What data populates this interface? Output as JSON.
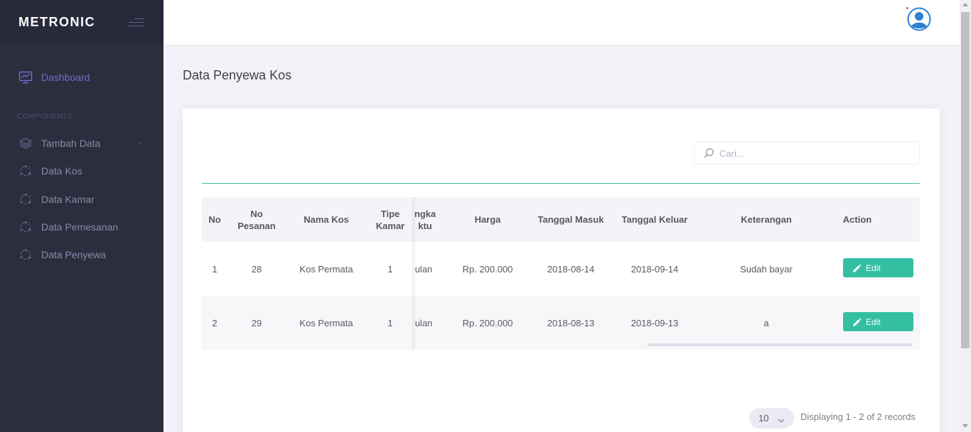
{
  "brand": {
    "logo_text": "METRONIC"
  },
  "sidebar": {
    "section_title": "COMPONENTS",
    "items": [
      {
        "label": "Dashboard",
        "icon": "chart-icon",
        "active": true
      },
      {
        "label": "Tambah Data",
        "icon": "layers-icon",
        "has_submenu": true
      },
      {
        "label": "Data Kos",
        "icon": "network-icon"
      },
      {
        "label": "Data Kamar",
        "icon": "network-icon"
      },
      {
        "label": "Data Pemesanan",
        "icon": "network-icon"
      },
      {
        "label": "Data Penyewa",
        "icon": "network-icon"
      }
    ]
  },
  "page": {
    "title": "Data Penyewa Kos"
  },
  "search": {
    "placeholder": "Cari..."
  },
  "table": {
    "columns": [
      "No",
      "No Pesanan",
      "Nama Kos",
      "Tipe Kamar",
      "ngka ktu",
      "Harga",
      "Tanggal Masuk",
      "Tanggal Keluar",
      "Keterangan",
      "Action"
    ],
    "rows": [
      {
        "no": "1",
        "no_pesanan": "28",
        "nama_kos": "Kos Permata",
        "tipe_kamar": "1",
        "jangka": "ulan",
        "harga": "Rp. 200.000",
        "tanggal_masuk": "2018-08-14",
        "tanggal_keluar": "2018-09-14",
        "keterangan": "Sudah bayar",
        "action": "Edit"
      },
      {
        "no": "2",
        "no_pesanan": "29",
        "nama_kos": "Kos Permata",
        "tipe_kamar": "1",
        "jangka": "ulan",
        "harga": "Rp. 200.000",
        "tanggal_masuk": "2018-08-13",
        "tanggal_keluar": "2018-09-13",
        "keterangan": "a",
        "action": "Edit"
      }
    ]
  },
  "pagination": {
    "page_size": "10",
    "info": "Displaying 1 - 2 of 2 records"
  },
  "colors": {
    "accent": "#716aca",
    "success": "#34bfa3",
    "sidebar_bg": "#2c2e3e"
  }
}
